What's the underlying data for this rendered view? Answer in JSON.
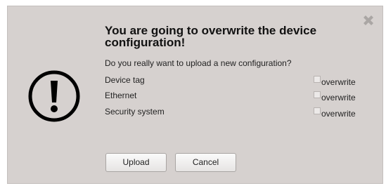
{
  "dialog": {
    "title": "You are going to overwrite the device configuration!",
    "question": "Do you really want to upload a new configuration?",
    "options": [
      {
        "label": "Device tag",
        "checkbox_label": "overwrite",
        "checked": false
      },
      {
        "label": "Ethernet",
        "checkbox_label": "overwrite",
        "checked": false
      },
      {
        "label": "Security system",
        "checkbox_label": "overwrite",
        "checked": false
      }
    ],
    "buttons": {
      "upload_label": "Upload",
      "cancel_label": "Cancel"
    },
    "icons": {
      "close": "close-x-icon",
      "warning": "exclamation-circle-icon"
    },
    "colors": {
      "dialog_background": "#d6d1cf",
      "close_icon": "#aaa6a4",
      "warning_icon": "#000000"
    }
  }
}
